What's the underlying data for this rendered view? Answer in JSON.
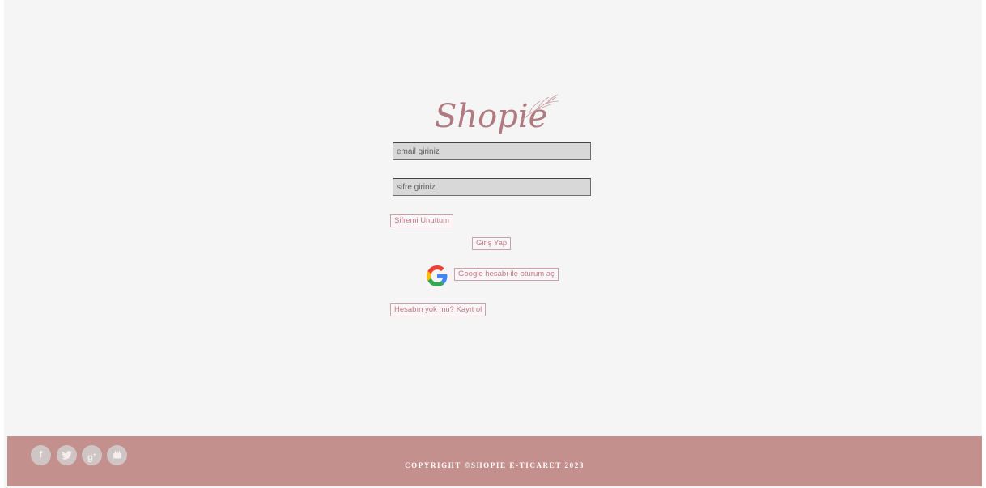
{
  "brand": {
    "logo_text": "Shopie",
    "color": "#b07a80"
  },
  "form": {
    "email_placeholder": "email giriniz",
    "password_placeholder": "sifre giriniz",
    "forgot_label": "Şifremi Unuttum",
    "login_label": "Giriş Yap",
    "google_label": "Google hesabı ile oturum aç",
    "signup_label": "Hesabın yok mu? Kayıt ol"
  },
  "icons": {
    "google": "google-g-icon",
    "social": [
      "facebook-icon",
      "twitter-icon",
      "google-plus-icon",
      "youtube-icon"
    ]
  },
  "footer": {
    "copyright": "COPYRIGHT ©SHOPIE E-TICARET 2023",
    "background": "#c3908e"
  }
}
